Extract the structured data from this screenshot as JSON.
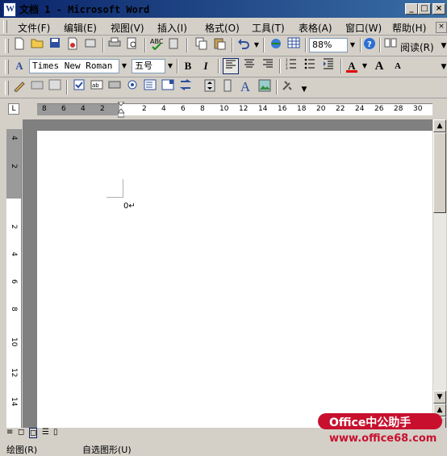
{
  "window": {
    "title": "文档 1 - Microsoft Word",
    "min_label": "_",
    "max_label": "□",
    "close_label": "×",
    "app_icon": "W"
  },
  "menu": {
    "items": [
      "文件(F)",
      "编辑(E)",
      "视图(V)",
      "插入(I)",
      "格式(O)",
      "工具(T)",
      "表格(A)",
      "窗口(W)",
      "帮助(H)"
    ]
  },
  "standard_toolbar": {
    "zoom": "88%",
    "read_label": "阅读(R)"
  },
  "format_toolbar": {
    "style_icon": "A",
    "font_name": "Times New Roman",
    "font_size": "五号",
    "bold": "B",
    "italic": "I",
    "font_color": "A",
    "grow_font": "A",
    "shrink_font": "A"
  },
  "ruler": {
    "h_labels": [
      "8",
      "6",
      "4",
      "2",
      "2",
      "4",
      "6",
      "8",
      "10",
      "12",
      "14",
      "16",
      "18",
      "20",
      "22",
      "24",
      "26",
      "28",
      "30"
    ],
    "v_labels": [
      "4",
      "2",
      "2",
      "4",
      "6",
      "8",
      "10",
      "12",
      "14"
    ]
  },
  "document": {
    "text": "0↵"
  },
  "bottom": {
    "draw_label": "绘图(R)",
    "autoshape_label": "自选图形(U)"
  },
  "watermark": {
    "line1": "Office中公助手",
    "line2": "www.office68.com"
  },
  "colors": {
    "titlebar_start": "#0a246a",
    "titlebar_end": "#3a6ea5",
    "toolbar": "#d4d0c8",
    "font_color_red": "#e00000",
    "watermark_red": "#c8102e"
  }
}
